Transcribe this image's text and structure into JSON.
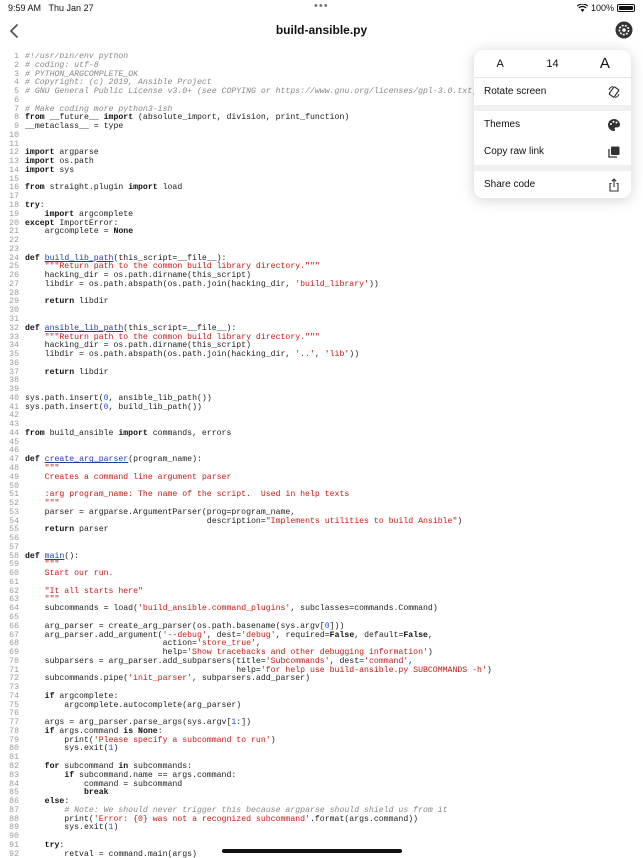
{
  "status_bar": {
    "time": "9:59 AM",
    "date": "Thu Jan 27",
    "battery": "100%"
  },
  "nav": {
    "title": "build-ansible.py",
    "back_icon": "chevron-left-icon",
    "settings_icon": "gear-icon"
  },
  "popover": {
    "font_small": "A",
    "font_size": "14",
    "font_large": "A",
    "items": [
      {
        "label": "Rotate screen",
        "icon": "rotate-icon"
      },
      {
        "label": "Themes",
        "icon": "palette-icon"
      },
      {
        "label": "Copy raw link",
        "icon": "copy-icon"
      },
      {
        "label": "Share code",
        "icon": "share-icon"
      }
    ]
  },
  "code_lines": [
    "#!/usr/bin/env python",
    "# coding: utf-8",
    "# PYTHON_ARGCOMPLETE_OK",
    "# Copyright: (c) 2019, Ansible Project",
    "# GNU General Public License v3.0+ (see COPYING or https://www.gnu.org/licenses/gpl-3.0.txt)",
    "",
    "# Make coding more python3-ish",
    "from __future__ import (absolute_import, division, print_function)",
    "__metaclass__ = type",
    "",
    "",
    "import argparse",
    "import os.path",
    "import sys",
    "",
    "from straight.plugin import load",
    "",
    "try:",
    "    import argcomplete",
    "except ImportError:",
    "    argcomplete = None",
    "",
    "",
    "def build_lib_path(this_script=__file__):",
    "    \"\"\"Return path to the common build library directory.\"\"\"",
    "    hacking_dir = os.path.dirname(this_script)",
    "    libdir = os.path.abspath(os.path.join(hacking_dir, 'build_library'))",
    "",
    "    return libdir",
    "",
    "",
    "def ansible_lib_path(this_script=__file__):",
    "    \"\"\"Return path to the common build library directory.\"\"\"",
    "    hacking_dir = os.path.dirname(this_script)",
    "    libdir = os.path.abspath(os.path.join(hacking_dir, '..', 'lib'))",
    "",
    "    return libdir",
    "",
    "",
    "sys.path.insert(0, ansible_lib_path())",
    "sys.path.insert(0, build_lib_path())",
    "",
    "",
    "from build_ansible import commands, errors",
    "",
    "",
    "def create_arg_parser(program_name):",
    "    \"\"\"",
    "    Creates a command line argument parser",
    "",
    "    :arg program_name: The name of the script.  Used in help texts",
    "    \"\"\"",
    "    parser = argparse.ArgumentParser(prog=program_name,",
    "                                     description=\"Implements utilities to build Ansible\")",
    "    return parser",
    "",
    "",
    "def main():",
    "    \"\"\"",
    "    Start our run.",
    "",
    "    \"It all starts here\"",
    "    \"\"\"",
    "    subcommands = load('build_ansible.command_plugins', subclasses=commands.Command)",
    "",
    "    arg_parser = create_arg_parser(os.path.basename(sys.argv[0]))",
    "    arg_parser.add_argument('--debug', dest='debug', required=False, default=False,",
    "                            action='store_true',",
    "                            help='Show tracebacks and other debugging information')",
    "    subparsers = arg_parser.add_subparsers(title='Subcommands', dest='command',",
    "                                           help='for help use build-ansible.py SUBCOMMANDS -h')",
    "    subcommands.pipe('init_parser', subparsers.add_parser)",
    "",
    "    if argcomplete:",
    "        argcomplete.autocomplete(arg_parser)",
    "",
    "    args = arg_parser.parse_args(sys.argv[1:])",
    "    if args.command is None:",
    "        print('Please specify a subcommand to run')",
    "        sys.exit(1)",
    "",
    "    for subcommand in subcommands:",
    "        if subcommand.name == args.command:",
    "            command = subcommand",
    "            break",
    "    else:",
    "        # Note: We should never trigger this because argparse should shield us from it",
    "        print('Error: {0} was not a recognized subcommand'.format(args.command))",
    "        sys.exit(1)",
    "",
    "    try:",
    "        retval = command.main(args)"
  ]
}
